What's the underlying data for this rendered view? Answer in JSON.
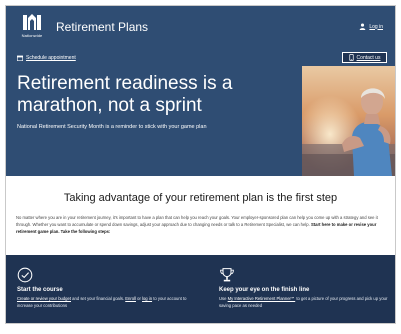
{
  "header": {
    "logo_text": "Nationwide",
    "app_title": "Retirement Plans",
    "login_label": "Log in"
  },
  "hero": {
    "schedule_label": "Schedule appointment",
    "contact_label": "Contact us",
    "headline": "Retirement readiness is a marathon, not a sprint",
    "subline": "National Retirement Security Month is a reminder to stick with your game plan"
  },
  "intro": {
    "title": "Taking advantage of your retirement plan is the first step",
    "body": "No matter where you are in your retirement journey, it's important to have a plan that can help you reach your goals. Your employer-sponsored plan can help you come up with a strategy and see it through. Whether you want to accumulate or spend down savings, adjust your approach due to changing needs or talk to a Retirement Specialist, we can help. ",
    "body_bold": "Start here to make or revise your retirement game plan. Take the following steps:"
  },
  "features": [
    {
      "icon": "checkmark-circle-icon",
      "title": "Start the course",
      "link1": "Create or review your budget",
      "text1": " and set your financial goals. ",
      "link2": "Enroll",
      "text2": " or ",
      "link3": "log in",
      "text3": " to your account to increase your contributions"
    },
    {
      "icon": "trophy-icon",
      "title": "Keep your eye on the finish line",
      "text1": "Use ",
      "link1": "My Interactive Retirement Planner℠",
      "text2": " to get a picture of your progress and pick up your saving pace as needed"
    }
  ],
  "colors": {
    "header_bg": "#2f4d73",
    "footer_bg": "#1f3352",
    "text_on_dark": "#ffffff"
  }
}
